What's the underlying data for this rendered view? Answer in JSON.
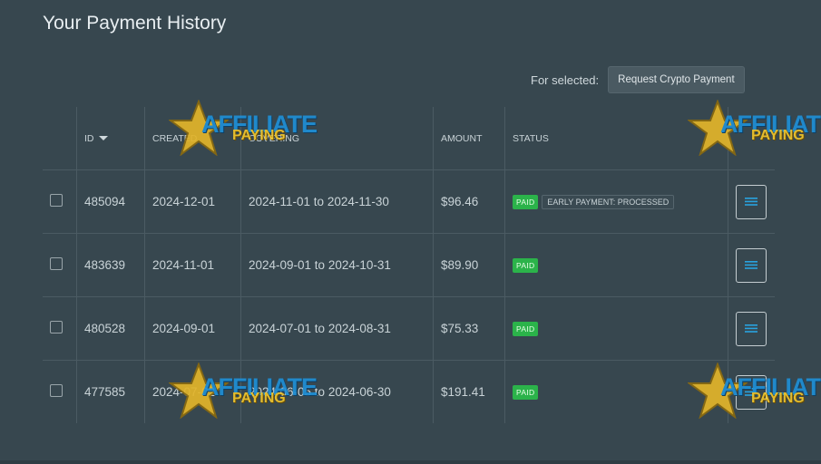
{
  "page": {
    "title": "Your Payment History"
  },
  "actions": {
    "label": "For selected:",
    "button": "Request Crypto Payment"
  },
  "table": {
    "headers": [
      "ID",
      "CREATED",
      "COVERING",
      "AMOUNT",
      "STATUS"
    ],
    "rows": [
      {
        "id": "485094",
        "created": "2024-12-01",
        "covering": "2024-11-01 to 2024-11-30",
        "amount": "$96.46",
        "status": "PAID",
        "extra": "EARLY PAYMENT: PROCESSED"
      },
      {
        "id": "483639",
        "created": "2024-11-01",
        "covering": "2024-09-01 to 2024-10-31",
        "amount": "$89.90",
        "status": "PAID"
      },
      {
        "id": "480528",
        "created": "2024-09-01",
        "covering": "2024-07-01 to 2024-08-31",
        "amount": "$75.33",
        "status": "PAID"
      },
      {
        "id": "477585",
        "created": "2024-07-02",
        "covering": "2024-06-05 to 2024-06-30",
        "amount": "$191.41",
        "status": "PAID"
      }
    ]
  },
  "watermark": {
    "line1": "AFFILIATE",
    "line2": "PAYING"
  },
  "colors": {
    "background": "#37474f",
    "paid": "#2bb34a",
    "icon": "#29a3e0"
  }
}
